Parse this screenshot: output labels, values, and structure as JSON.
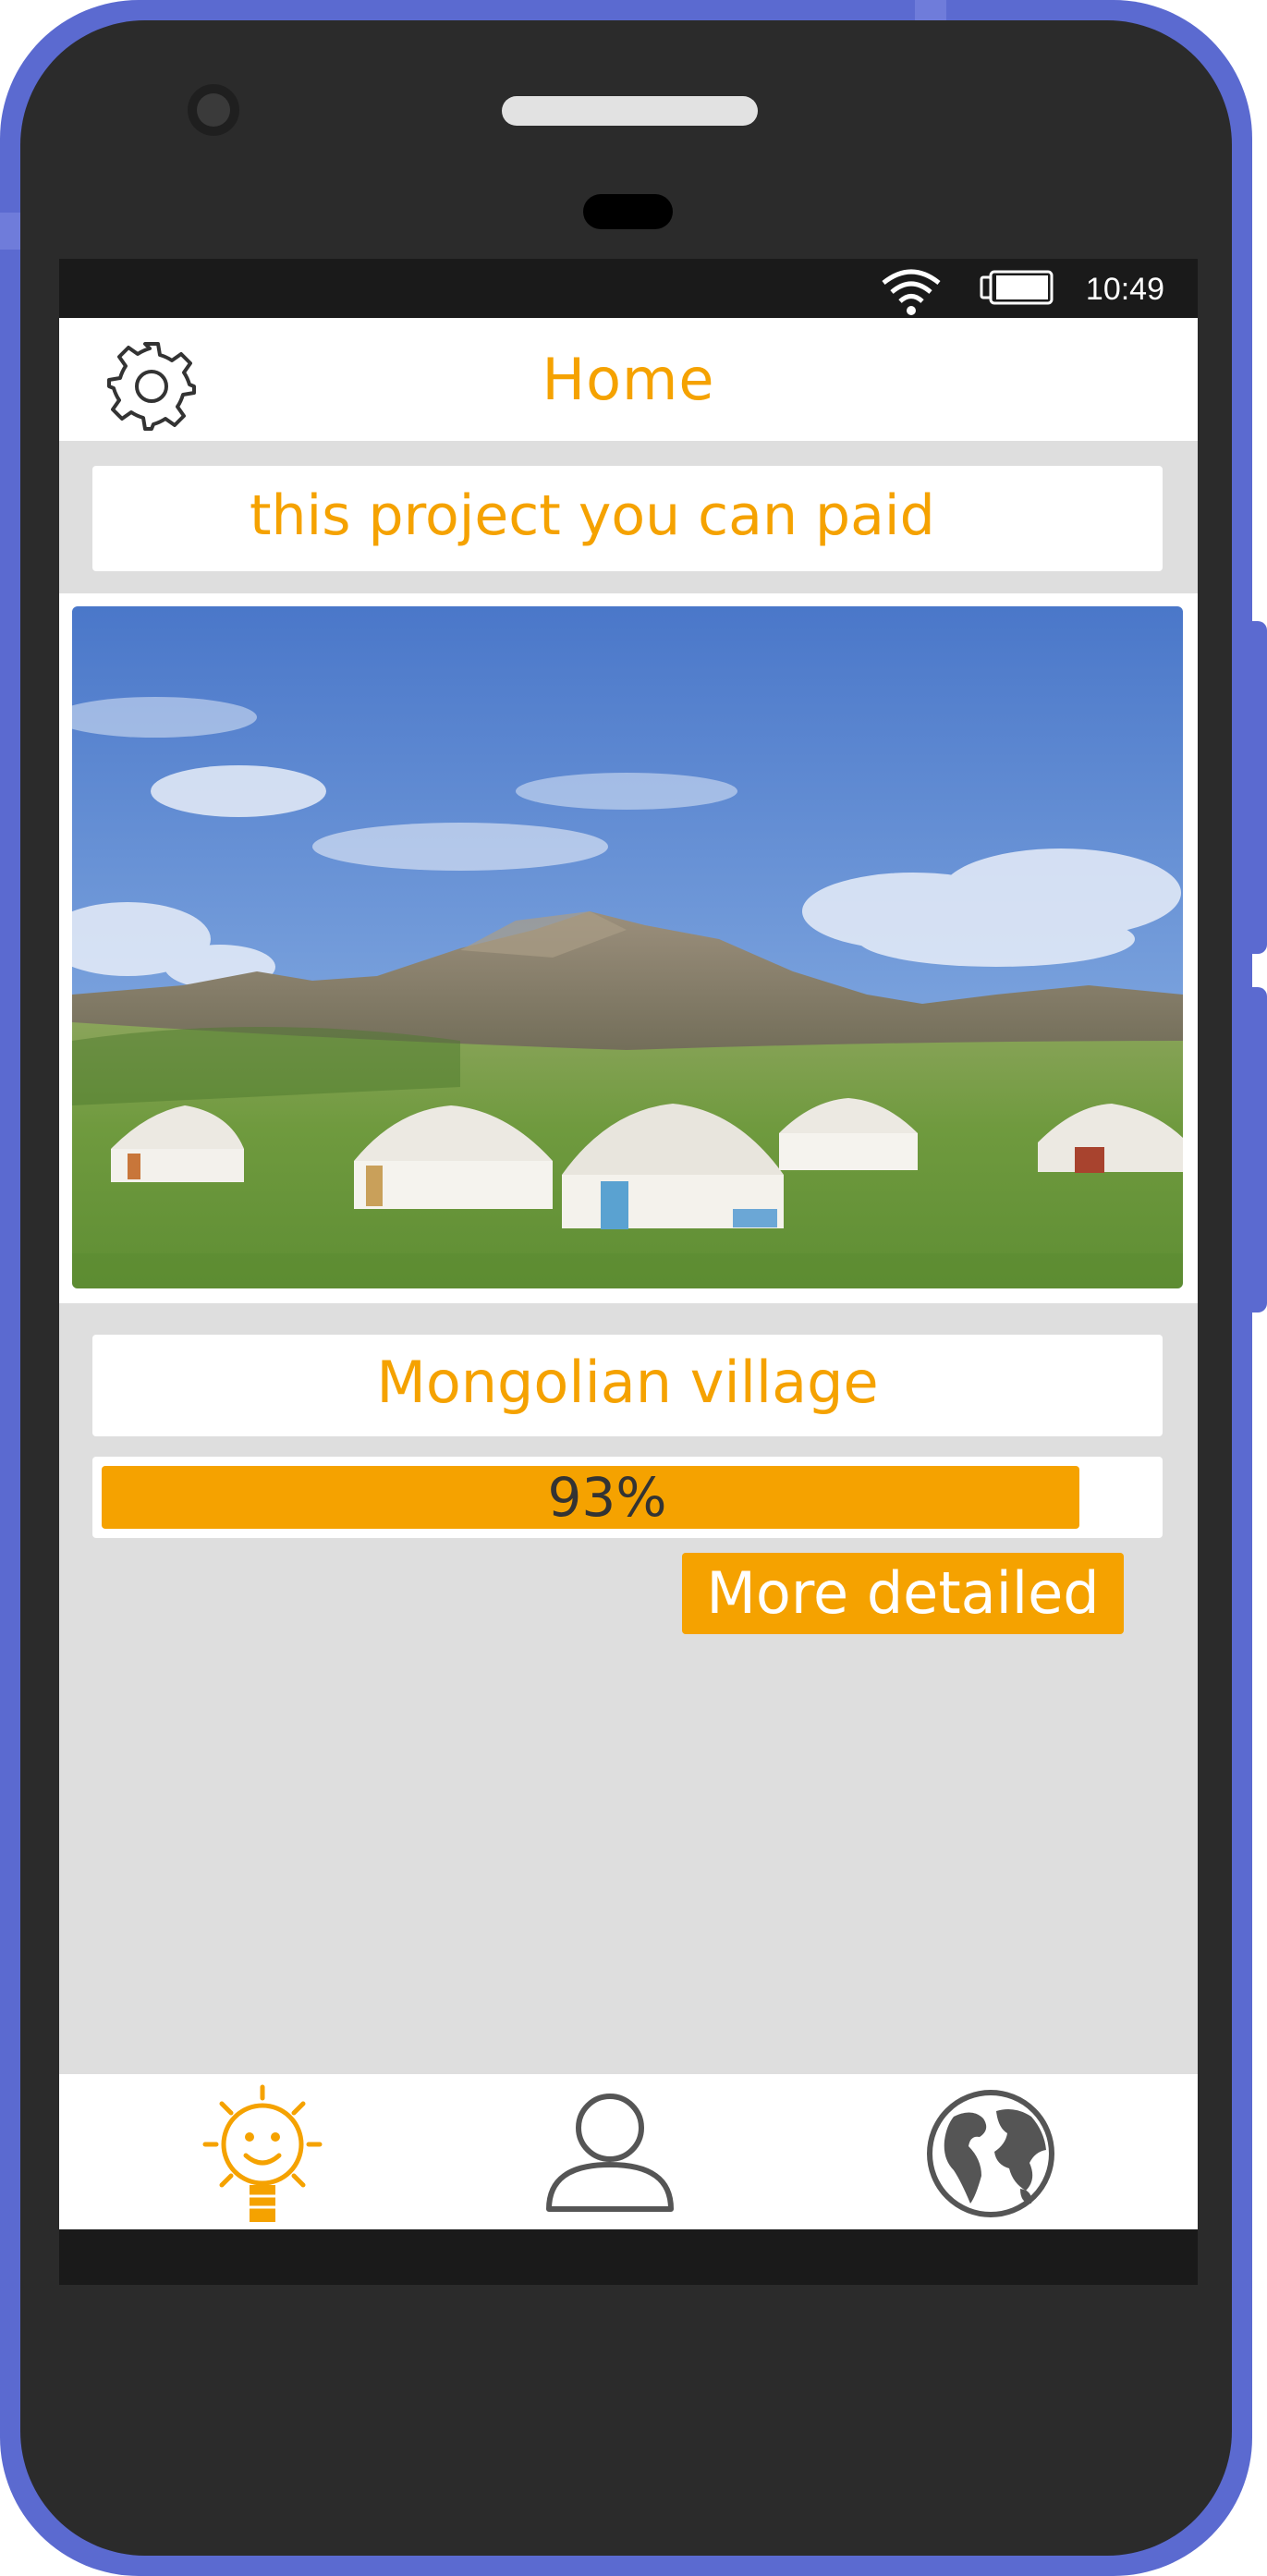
{
  "status": {
    "time": "10:49"
  },
  "header": {
    "title": "Home"
  },
  "banner": {
    "text": "this project you can paid"
  },
  "project": {
    "name": "Mongolian village",
    "progress_label": "93%",
    "progress_value": 0.93
  },
  "actions": {
    "more_label": "More detailed"
  },
  "colors": {
    "accent": "#f5a200",
    "frame": "#5b6ad0",
    "bezel": "#2b2b2b",
    "background": "#dedede",
    "icon_gray": "#555555"
  },
  "icons": {
    "settings": "gear-icon",
    "nav_home": "sun-bulb-icon",
    "nav_profile": "user-icon",
    "nav_world": "globe-icon",
    "wifi": "wifi-icon",
    "battery": "battery-icon"
  }
}
